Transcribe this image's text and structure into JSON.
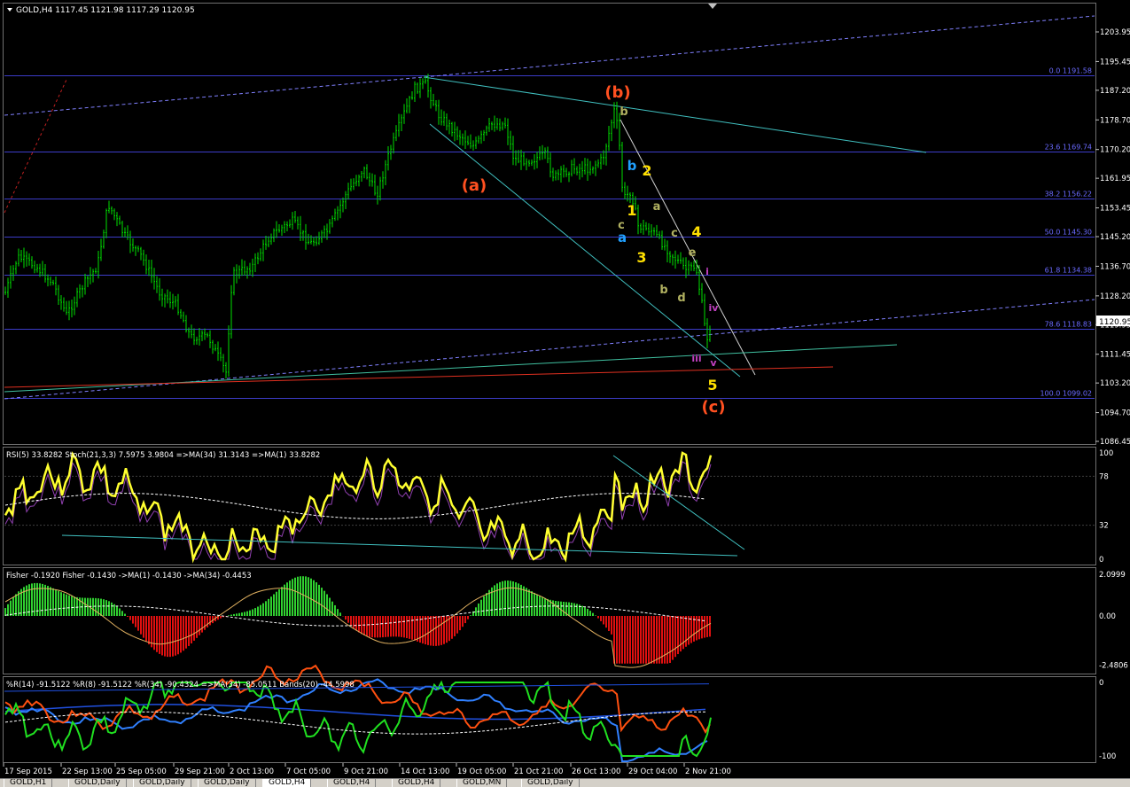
{
  "header": {
    "title": "GOLD,H4  1117.45 1121.98 1117.29 1120.95"
  },
  "colors": {
    "background": "#000000",
    "grid": "#1e1e78",
    "candle": "#00e000",
    "fib": "#3c3cc8",
    "price_label": "#ffffff"
  },
  "main": {
    "price_axis": [
      "1203.95",
      "1195.45",
      "1187.20",
      "1178.70",
      "1170.20",
      "1161.95",
      "1153.45",
      "1145.20",
      "1136.70",
      "1128.20",
      "1119.95",
      "1111.45",
      "1103.20",
      "1094.70",
      "1086.45"
    ],
    "current_price": "1120.95",
    "fib_levels": [
      {
        "label": "0.0 1191.58",
        "price": 1191.58
      },
      {
        "label": "23.6 1169.74",
        "price": 1169.74
      },
      {
        "label": "38.2 1156.22",
        "price": 1156.22
      },
      {
        "label": "50.0 1145.30",
        "price": 1145.3
      },
      {
        "label": "61.8 1134.38",
        "price": 1134.38
      },
      {
        "label": "78.6 1118.83",
        "price": 1118.83
      },
      {
        "label": "100.0 1099.02",
        "price": 1099.02
      }
    ],
    "wave_labels": [
      {
        "t": "(b)",
        "color": "#ff5020",
        "size": 18
      },
      {
        "t": "(a)",
        "color": "#ff5020",
        "size": 18
      },
      {
        "t": "(c)",
        "color": "#ff5020",
        "size": 18
      },
      {
        "t": "b",
        "color": "#b0b060",
        "size": 13
      },
      {
        "t": "b",
        "color": "#20a0ff",
        "size": 15
      },
      {
        "t": "2",
        "color": "#ffe000",
        "size": 16
      },
      {
        "t": "1",
        "color": "#ffe000",
        "size": 16
      },
      {
        "t": "a",
        "color": "#b0b060",
        "size": 13
      },
      {
        "t": "c",
        "color": "#b0b060",
        "size": 13
      },
      {
        "t": "a",
        "color": "#20a0ff",
        "size": 15
      },
      {
        "t": "c",
        "color": "#b0b060",
        "size": 13
      },
      {
        "t": "4",
        "color": "#ffe000",
        "size": 16
      },
      {
        "t": "3",
        "color": "#ffe000",
        "size": 16
      },
      {
        "t": "e",
        "color": "#b0b060",
        "size": 13
      },
      {
        "t": "b",
        "color": "#b0b060",
        "size": 13
      },
      {
        "t": "d",
        "color": "#b0b060",
        "size": 13
      },
      {
        "t": "i",
        "color": "#c040c0",
        "size": 11
      },
      {
        "t": "iv",
        "color": "#c040c0",
        "size": 11
      },
      {
        "t": "iii",
        "color": "#c040c0",
        "size": 11
      },
      {
        "t": "v",
        "color": "#c040c0",
        "size": 11
      },
      {
        "t": "5",
        "color": "#ffe000",
        "size": 16
      }
    ]
  },
  "rsi": {
    "title": "RSI(5) 33.8282  Stoch(21,3,3) 7.5975 3.9804  =>MA(34) 31.3143  =>MA(1) 33.8282",
    "axis": [
      "100",
      "78",
      "32",
      "0"
    ]
  },
  "fisher": {
    "title": "Fisher -0.1920  Fisher -0.1430  ->MA(1) -0.1430  ->MA(34) -0.4453",
    "axis": [
      "2.0999",
      "0.00",
      "-2.4806"
    ]
  },
  "wpr": {
    "title": "%R(14) -91.5122  %R(8) -91.5122  %R(34) -90.4324  =>MA(34) -85.0511  Bands(20) -44.5998",
    "axis": [
      "0",
      "-100"
    ]
  },
  "time_axis": [
    "17 Sep 2015",
    "22 Sep 13:00",
    "25 Sep 05:00",
    "29 Sep 21:00",
    "2 Oct 13:00",
    "7 Oct 05:00",
    "9 Oct 21:00",
    "14 Oct 13:00",
    "19 Oct 05:00",
    "21 Oct 21:00",
    "26 Oct 13:00",
    "29 Oct 04:00",
    "2 Nov 21:00"
  ],
  "tabs": [
    "GOLD,H1",
    "GOLD,Daily",
    "GOLD,Daily",
    "GOLD,Daily",
    "GOLD,H4",
    "GOLD,H4",
    "GOLD,H4",
    "GOLD,MN",
    "GOLD,Daily"
  ],
  "active_tab": 4
}
